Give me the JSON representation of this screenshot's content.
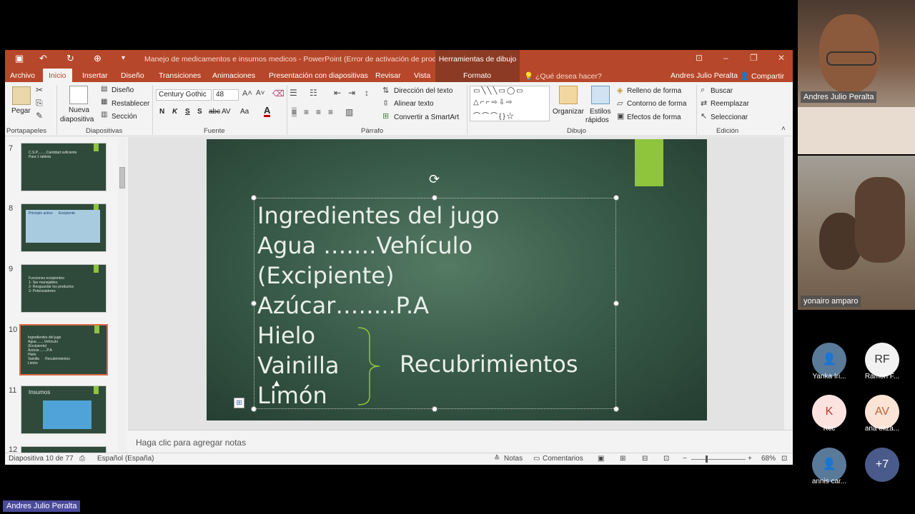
{
  "window": {
    "doc_title": "Manejo de medicamentos e insumos medicos - PowerPoint (Error de activación de productos)",
    "context_tools": "Herramientas de dibujo",
    "user": "Andres Julio Peralta",
    "share": "Compartir",
    "tell_me": "¿Qué desea hacer?"
  },
  "tabs": [
    "Archivo",
    "Inicio",
    "Insertar",
    "Diseño",
    "Transiciones",
    "Animaciones",
    "Presentación con diapositivas",
    "Revisar",
    "Vista",
    "Formato"
  ],
  "ribbon": {
    "paste": "Pegar",
    "new_slide_1": "Nueva",
    "new_slide_2": "diapositiva",
    "design": "Diseño",
    "reset": "Restablecer",
    "section": "Sección",
    "font_name": "Century Gothic",
    "font_size": "48",
    "bold": "N",
    "italic": "K",
    "underline": "S",
    "strike": "S",
    "spacing": "AV",
    "case": "Aa",
    "text_direction": "Dirección del texto",
    "align_text": "Alinear texto",
    "smartart": "Convertir a SmartArt",
    "organize": "Organizar",
    "quick_styles_1": "Estilos",
    "quick_styles_2": "rápidos",
    "shape_fill": "Relleno de forma",
    "shape_outline": "Contorno de forma",
    "shape_effects": "Efectos de forma",
    "find": "Buscar",
    "replace": "Reemplazar",
    "select": "Seleccionar",
    "groups": [
      "Portapapeles",
      "Diapositivas",
      "Fuente",
      "Párrafo",
      "Dibujo",
      "Edición"
    ]
  },
  "thumbnails": [
    {
      "num": "7",
      "text": "C.S.P.........Cantidad suficiente\nPara 1 tableta",
      "selected": false
    },
    {
      "num": "8",
      "text": "Principio activo      Excipiente",
      "selected": false
    },
    {
      "num": "9",
      "text": "Funciones excipientes:\n1- Ser manejables\n2- Resguardar los productos\n3- Potenciadores",
      "selected": false
    },
    {
      "num": "10",
      "text": "Ingredientes del jugo\nAgua .......Vehículo\n(Excipiente)\nAzúcar........P.A\nHielo\nVainilla      Recubrimientos\nLimón",
      "selected": true
    },
    {
      "num": "11",
      "text": "Insumos",
      "selected": false
    },
    {
      "num": "12",
      "text": "",
      "selected": false
    }
  ],
  "slide": {
    "lines": [
      "Ingredientes del jugo",
      "Agua …….Vehículo",
      "(Excipiente)",
      "Azúcar……..P.A",
      "Hielo",
      "Vainilla",
      "Limón"
    ],
    "recubrimientos": "Recubrimientos"
  },
  "notes_placeholder": "Haga clic para agregar notas",
  "status": {
    "slide_count": "Diapositiva 10 de 77",
    "language": "Español (España)",
    "notes": "Notas",
    "comments": "Comentarios",
    "zoom": "68%"
  },
  "participants": {
    "video1_name": "Andres Julio Peralta",
    "video2_name": "yonairo amparo",
    "tiles": [
      {
        "initials": "",
        "name": "Yanka Iri...",
        "color": "#5a7a9a",
        "icon": "person-icon"
      },
      {
        "initials": "RF",
        "name": "Ramon F...",
        "color": "#f2f2f2"
      },
      {
        "initials": "K",
        "name": "Kcc",
        "color": "#fde3e0"
      },
      {
        "initials": "AV",
        "name": "ana eliza...",
        "color": "#fbe4d6"
      },
      {
        "initials": "",
        "name": "annis car...",
        "color": "#5a7a9a",
        "icon": "person-icon"
      },
      {
        "initials": "+7",
        "name": "",
        "color": "#4a5a8a"
      }
    ]
  },
  "presenter_name": "Andres Julio Peralta"
}
